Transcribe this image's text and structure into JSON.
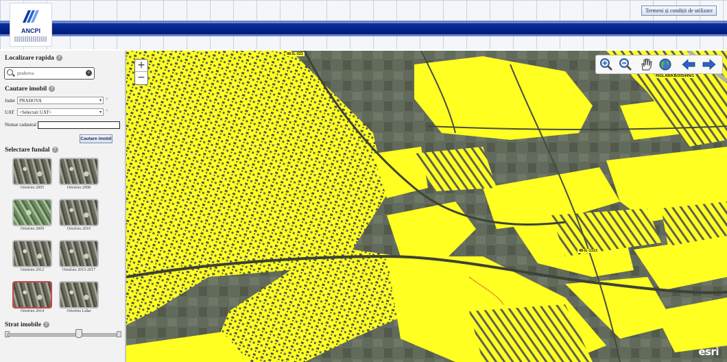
{
  "header": {
    "logo_text": "ANCPI",
    "terms_button": "Termeni și condiții de utilizare"
  },
  "sidebar": {
    "quick_search": {
      "title": "Localizare rapida",
      "value": "prahova"
    },
    "property_search": {
      "title": "Cautare imobil",
      "county_label": "Judet",
      "county_value": "PRAHOVA",
      "uat_label": "UAT",
      "uat_value": "<Selectati UAT>",
      "cadastral_label": "Numar cadastral",
      "cadastral_value": "",
      "search_button": "Cautare imobil"
    },
    "basemap": {
      "title": "Selectare fundal",
      "items": [
        {
          "label": "Ortofoto 2005",
          "style": "grey",
          "selected": false
        },
        {
          "label": "Ortofoto 2008",
          "style": "grey",
          "selected": false
        },
        {
          "label": "Ortofoto 2009",
          "style": "green",
          "selected": false
        },
        {
          "label": "Ortofoto 2010",
          "style": "grey",
          "selected": false
        },
        {
          "label": "Ortofoto 2012",
          "style": "grey",
          "selected": false
        },
        {
          "label": "Ortofoto 2015-2017",
          "style": "grey",
          "selected": false
        },
        {
          "label": "Ortofoto 2014",
          "style": "grey",
          "selected": true
        },
        {
          "label": "Ortofoto Lidar",
          "style": "grey",
          "selected": false
        }
      ]
    },
    "layer": {
      "title": "Strat imobile",
      "opacity": 0.65
    }
  },
  "map": {
    "zoom_in": "+",
    "zoom_out": "−",
    "tools": [
      "zoom-in-icon",
      "zoom-out-icon",
      "pan-hand-icon",
      "globe-icon",
      "back-arrow-icon",
      "forward-arrow-icon"
    ],
    "parcel_labels": [
      "48-IL-321",
      "RIGLAB/KB/2054/IN/1",
      "48-IL-1313"
    ],
    "attribution": "esri",
    "colors": {
      "parcel_fill": "#ffff22",
      "imagery_dark": "#5f6658",
      "imagery_light": "#8b9080"
    }
  }
}
